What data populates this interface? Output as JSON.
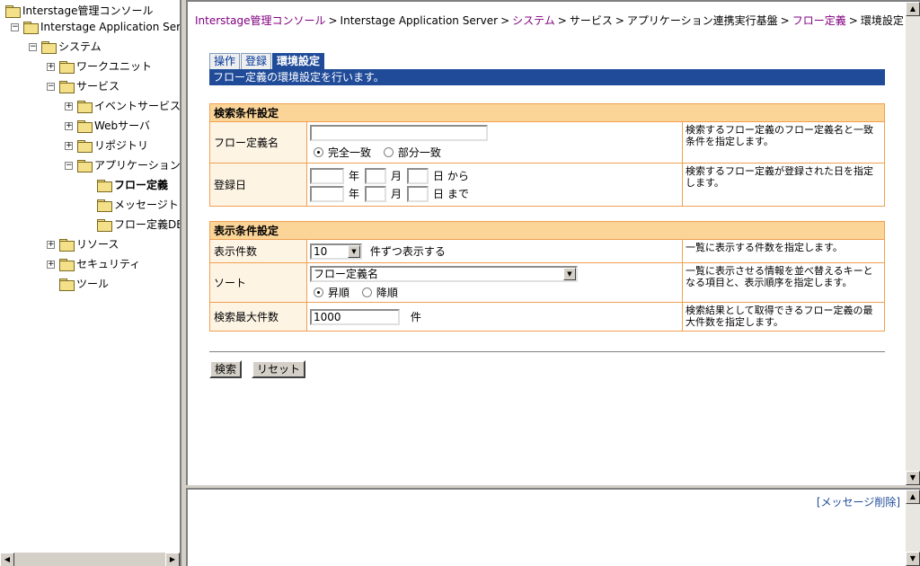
{
  "tree": {
    "root": "Interstage管理コンソール",
    "server": "Interstage Application Server",
    "system": "システム",
    "workunit": "ワークユニット",
    "services": "サービス",
    "event_service": "イベントサービス",
    "web_server": "Webサーバ",
    "repository": "リポジトリ",
    "app_integration": "アプリケーション連",
    "flow_definition": "フロー定義",
    "message_tracking": "メッセージトラ",
    "flow_definition_db": "フロー定義DB",
    "resources": "リソース",
    "security": "セキュリティ",
    "tools": "ツール"
  },
  "breadcrumb": {
    "items": [
      {
        "label": "Interstage管理コンソール",
        "link": true
      },
      {
        "label": "Interstage Application Server",
        "link": false
      },
      {
        "label": "システム",
        "link": true
      },
      {
        "label": "サービス",
        "link": false
      },
      {
        "label": "アプリケーション連携実行基盤",
        "link": false
      },
      {
        "label": "フロー定義",
        "link": true
      },
      {
        "label": "環境設定",
        "link": false
      }
    ],
    "separator": ">"
  },
  "tabs": {
    "operation": "操作",
    "register": "登録",
    "environment": "環境設定"
  },
  "page_description": "フロー定義の環境設定を行います。",
  "search": {
    "section_title": "検索条件設定",
    "flow_name_label": "フロー定義名",
    "flow_name_value": "",
    "match_exact": "完全一致",
    "match_partial": "部分一致",
    "flow_name_help": "検索するフロー定義のフロー定義名と一致条件を指定します。",
    "reg_date_label": "登録日",
    "year": "年",
    "month": "月",
    "day_from": "日 から",
    "day_to": "日 まで",
    "reg_date_help": "検索するフロー定義が登録された日を指定します。"
  },
  "display": {
    "section_title": "表示条件設定",
    "count_label": "表示件数",
    "count_value": "10",
    "count_suffix": "件ずつ表示する",
    "count_help": "一覧に表示する件数を指定します。",
    "sort_label": "ソート",
    "sort_key": "フロー定義名",
    "sort_asc": "昇順",
    "sort_desc": "降順",
    "sort_help": "一覧に表示させる情報を並べ替えるキーとなる項目と、表示順序を指定します。",
    "max_label": "検索最大件数",
    "max_value": "1000",
    "max_unit": "件",
    "max_help": "検索結果として取得できるフロー定義の最大件数を指定します。"
  },
  "buttons": {
    "search": "検索",
    "reset": "リセット"
  },
  "message_panel": {
    "clear_link": "[メッセージ削除]"
  }
}
